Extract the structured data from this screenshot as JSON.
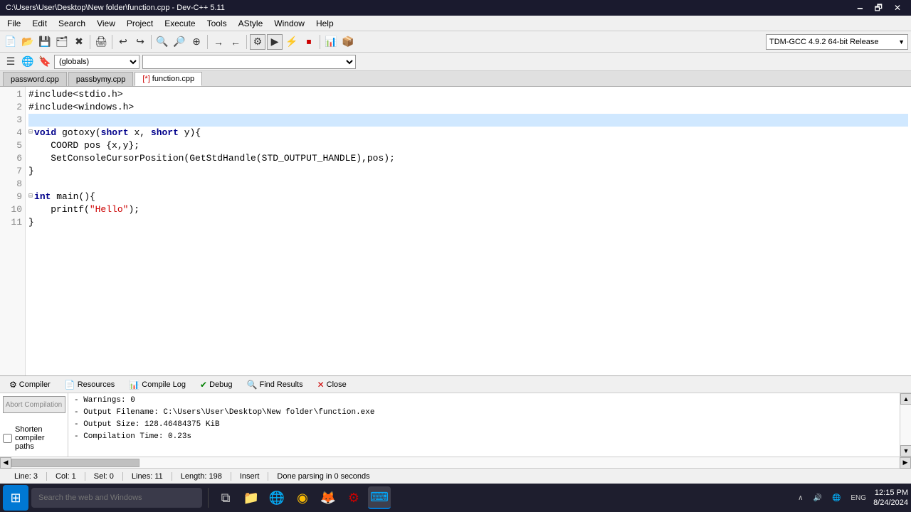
{
  "titlebar": {
    "title": "C:\\Users\\User\\Desktop\\New folder\\function.cpp - Dev-C++ 5.11",
    "minimize": "🗕",
    "maximize": "🗗",
    "close": "✕"
  },
  "menu": {
    "items": [
      "File",
      "Edit",
      "Search",
      "View",
      "Project",
      "Execute",
      "Tools",
      "AStyle",
      "Window",
      "Help"
    ]
  },
  "compiler_dropdown": "TDM-GCC 4.9.2  64-bit Release",
  "scope_select": "(globals)",
  "tabs": [
    {
      "label": "password.cpp",
      "active": false,
      "modified": false
    },
    {
      "label": "passbymy.cpp",
      "active": false,
      "modified": false
    },
    {
      "label": "function.cpp",
      "active": true,
      "modified": true
    }
  ],
  "code": {
    "lines": [
      {
        "num": 1,
        "fold": false,
        "content_html": "#include&lt;stdio.h&gt;"
      },
      {
        "num": 2,
        "fold": false,
        "content_html": "#include&lt;windows.h&gt;"
      },
      {
        "num": 3,
        "fold": false,
        "content_html": ""
      },
      {
        "num": 4,
        "fold": true,
        "content_html": "<span class='kw'>void</span> gotoxy(<span class='kw'>short</span> x, <span class='kw'>short</span> y){"
      },
      {
        "num": 5,
        "fold": false,
        "content_html": "    COORD pos {x,y};"
      },
      {
        "num": 6,
        "fold": false,
        "content_html": "    SetConsoleCursorPosition(GetStdHandle(STD_OUTPUT_HANDLE),pos);"
      },
      {
        "num": 7,
        "fold": false,
        "content_html": "}"
      },
      {
        "num": 8,
        "fold": false,
        "content_html": ""
      },
      {
        "num": 9,
        "fold": true,
        "content_html": "<span class='kw'>int</span> main(){"
      },
      {
        "num": 10,
        "fold": false,
        "content_html": "    printf(<span class='str'>\"Hello\"</span>);"
      },
      {
        "num": 11,
        "fold": false,
        "content_html": "}"
      }
    ]
  },
  "bottom_tabs": [
    {
      "label": "Compiler",
      "icon": "⚙"
    },
    {
      "label": "Resources",
      "icon": "📄"
    },
    {
      "label": "Compile Log",
      "icon": "📊"
    },
    {
      "label": "Debug",
      "icon": "✔"
    },
    {
      "label": "Find Results",
      "icon": "🔍"
    },
    {
      "label": "Close",
      "icon": "✕"
    }
  ],
  "abort_btn": "Abort Compilation",
  "shorten_label": "Shorten compiler paths",
  "log_lines": [
    "- Warnings: 0",
    "- Output Filename: C:\\Users\\User\\Desktop\\New folder\\function.exe",
    "- Output Size: 128.46484375 KiB",
    "- Compilation Time: 0.23s"
  ],
  "statusbar": {
    "line": "Line: 3",
    "col": "Col: 1",
    "sel": "Sel: 0",
    "lines": "Lines: 11",
    "length": "Length: 198",
    "mode": "Insert",
    "message": "Done parsing in 0 seconds"
  },
  "taskbar": {
    "search_placeholder": "Search the web and Windows",
    "time": "12:15 PM",
    "date": "8/24/2024",
    "system_icons": [
      "∧",
      "🔊",
      "🌐",
      "ENG"
    ]
  }
}
